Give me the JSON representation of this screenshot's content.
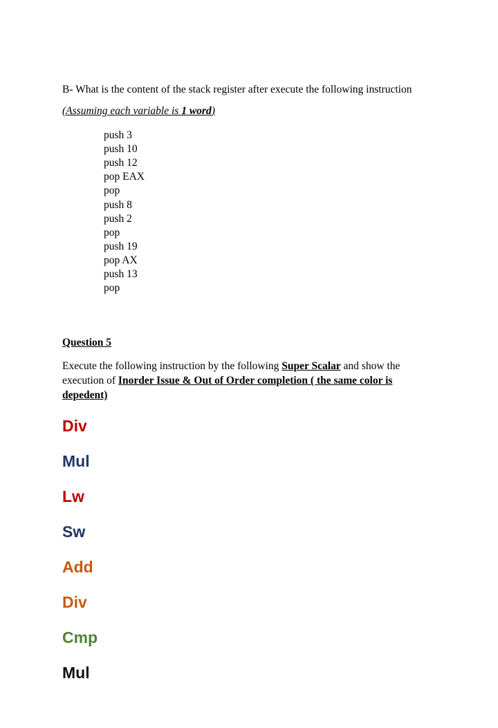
{
  "partB": {
    "title": "B- What is the content of the stack register after execute the following instruction",
    "assumption_prefix": "(Assuming each variable is ",
    "assumption_bold": "1 word",
    "assumption_suffix": ")",
    "code": [
      "push 3",
      "push 10",
      "push 12",
      "pop EAX",
      "pop",
      "push 8",
      "push 2",
      "pop",
      "push 19",
      "pop AX",
      "push 13",
      "pop"
    ]
  },
  "q5": {
    "heading": "Question 5",
    "intro_prefix": "Execute the following instruction by the following ",
    "intro_super_scalar": "Super Scalar",
    "intro_mid": " and show the execution of ",
    "intro_underline": "Inorder Issue & Out of Order completion ( the same color is depedent)",
    "instructions": [
      {
        "label": "Div",
        "color": "c-red"
      },
      {
        "label": "Mul",
        "color": "c-blue"
      },
      {
        "label": "Lw",
        "color": "c-red"
      },
      {
        "label": "Sw",
        "color": "c-blue"
      },
      {
        "label": "Add",
        "color": "c-brown"
      },
      {
        "label": "Div",
        "color": "c-brown"
      },
      {
        "label": "Cmp",
        "color": "c-green"
      },
      {
        "label": "Mul",
        "color": "c-black"
      }
    ]
  }
}
